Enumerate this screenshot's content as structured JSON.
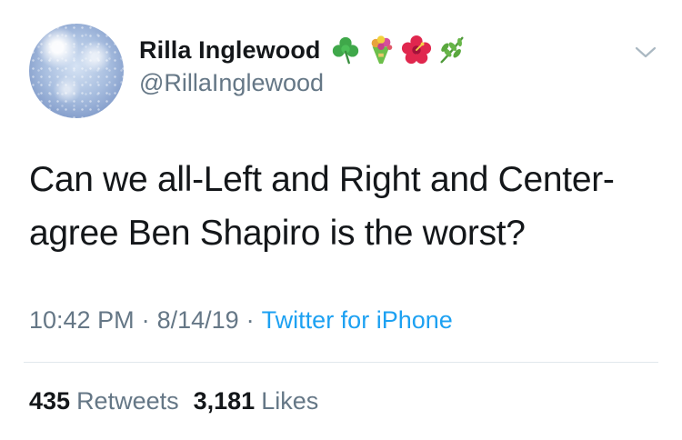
{
  "user": {
    "display_name": "Rilla Inglewood",
    "handle": "@RillaInglewood",
    "name_emojis": [
      "shamrock-icon",
      "bouquet-icon",
      "hibiscus-icon",
      "herb-icon"
    ]
  },
  "tweet": {
    "text_lines": [
      "Can we all-Left and Right and Center-",
      "agree Ben Shapiro is the worst?"
    ],
    "time": "10:42 PM",
    "separator": "·",
    "date": "8/14/19",
    "source": "Twitter for iPhone"
  },
  "stats": {
    "retweets_count": "435",
    "retweets_label": "Retweets",
    "likes_count": "3,181",
    "likes_label": "Likes"
  },
  "colors": {
    "text_primary": "#14171a",
    "text_secondary": "#657786",
    "link": "#1da1f2",
    "divider": "#e1e8ed"
  }
}
